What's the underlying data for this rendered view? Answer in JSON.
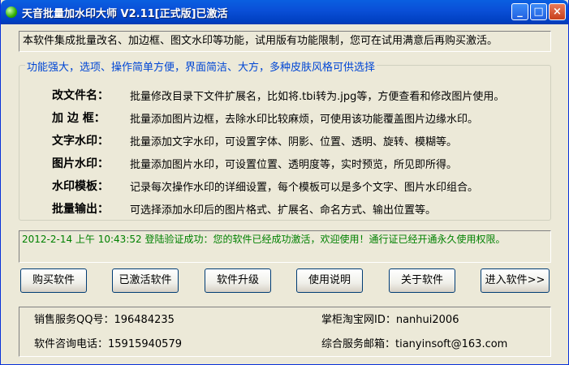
{
  "window": {
    "title": "天音批量加水印大师 V2.11[正式版]已激活",
    "minimize_label": "_",
    "maximize_label": "□",
    "close_label": "×"
  },
  "intro_text": "本软件集成批量改名、加边框、图文水印等功能，试用版有功能限制，您可在试用满意后再购买激活。",
  "features": {
    "legend": "功能强大，选项、操作简单方便，界面简洁、大方，多种皮肤风格可供选择",
    "items": [
      {
        "label": "改文件名：",
        "desc": "批量修改目录下文件扩展名，比如将.tbi转为.jpg等，方便查看和修改图片使用。"
      },
      {
        "label": "加 边 框：",
        "desc": "批量添加图片边框，去除水印比较麻烦，可使用该功能覆盖图片边缘水印。"
      },
      {
        "label": "文字水印：",
        "desc": "批量添加文字水印，可设置字体、阴影、位置、透明、旋转、模糊等。"
      },
      {
        "label": "图片水印：",
        "desc": "批量添加图片水印，可设置位置、透明度等，实时预览，所见即所得。"
      },
      {
        "label": "水印模板：",
        "desc": "记录每次操作水印的详细设置，每个模板可以是多个文字、图片水印组合。"
      },
      {
        "label": "批量输出：",
        "desc": "可选择添加水印后的图片格式、扩展名、命名方式、输出位置等。"
      }
    ]
  },
  "status_text": "2012-2-14 上午 10:43:52  登陆验证成功：您的软件已经成功激活，欢迎使用！通行证已经开通永久使用权限。",
  "buttons": {
    "buy": "购买软件",
    "activated": "已激活软件",
    "upgrade": "软件升级",
    "help": "使用说明",
    "about": "关于软件",
    "enter": "进入软件>>"
  },
  "contact": {
    "qq": "销售服务QQ号：196484235",
    "taobao": "掌柜淘宝网ID：nanhui2006",
    "phone": "软件咨询电话：15915940579",
    "email": "综合服务邮箱：tianyinsoft@163.com"
  }
}
